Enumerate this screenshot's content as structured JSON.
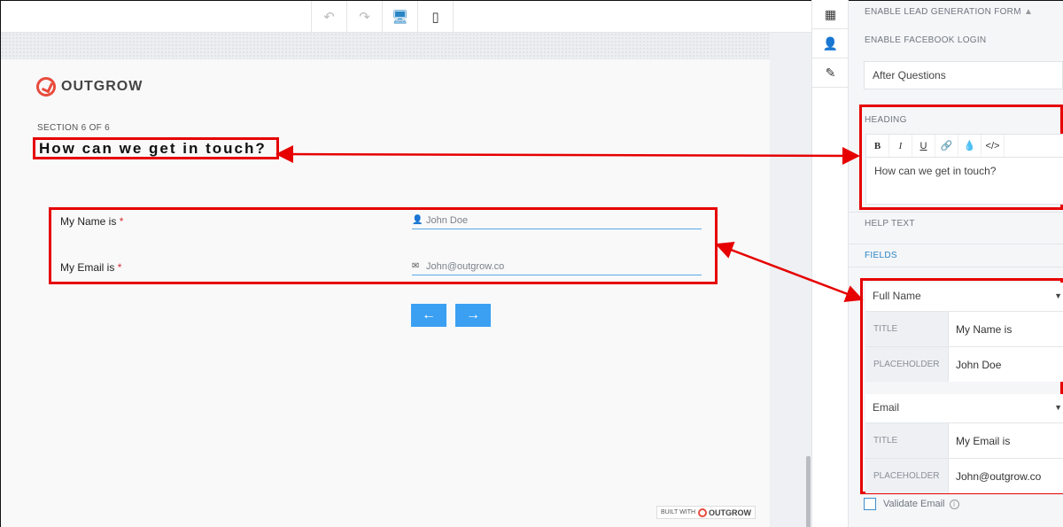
{
  "toolbar": {
    "buttons": [
      {
        "name": "undo-icon",
        "glyph": "↶"
      },
      {
        "name": "redo-icon",
        "glyph": "↷"
      },
      {
        "name": "desktop-preview-icon",
        "glyph": "🖥"
      },
      {
        "name": "mobile-preview-icon",
        "glyph": "▯"
      }
    ]
  },
  "canvas": {
    "logo_text": "OUTGROW",
    "section_label": "SECTION 6 OF 6",
    "heading": "How can we get in touch?",
    "fields": [
      {
        "label": "My Name is",
        "required_mark": "*",
        "icon": "user-icon",
        "icon_glyph": "👤",
        "placeholder": "John Doe"
      },
      {
        "label": "My Email is",
        "required_mark": "*",
        "icon": "mail-icon",
        "icon_glyph": "✉",
        "placeholder": "John@outgrow.co"
      }
    ],
    "prev_button": "←",
    "next_button": "→",
    "built_with": "BUILT WITH",
    "built_brand": "OUTGROW"
  },
  "rail": {
    "items": [
      {
        "name": "layout-icon",
        "glyph": "▦"
      },
      {
        "name": "add-user-icon",
        "glyph": "👤"
      },
      {
        "name": "pencil-icon",
        "glyph": "✎"
      }
    ]
  },
  "panel": {
    "enable_lead_form": "ENABLE LEAD GENERATION FORM",
    "warning_glyph": "▲",
    "enable_facebook": "ENABLE FACEBOOK LOGIN",
    "position_select": "After Questions",
    "heading_caption": "HEADING",
    "editor_buttons": [
      "B",
      "I",
      "U",
      "🔗",
      "💧",
      "</>"
    ],
    "heading_value": "How can we get in touch?",
    "help_text_caption": "HELP TEXT",
    "fields_caption": "FIELDS",
    "field_blocks": [
      {
        "type": "Full Name",
        "title_key": "TITLE",
        "title_value": "My Name is",
        "placeholder_key": "PLACEHOLDER",
        "placeholder_value": "John Doe"
      },
      {
        "type": "Email",
        "title_key": "TITLE",
        "title_value": "My Email is",
        "placeholder_key": "PLACEHOLDER",
        "placeholder_value": "John@outgrow.co"
      }
    ],
    "validate_email": "Validate Email"
  },
  "colors": {
    "accent": "#2a86c4",
    "button": "#3ba0f2",
    "annotation": "#e60000",
    "brand": "#e84c3d"
  }
}
